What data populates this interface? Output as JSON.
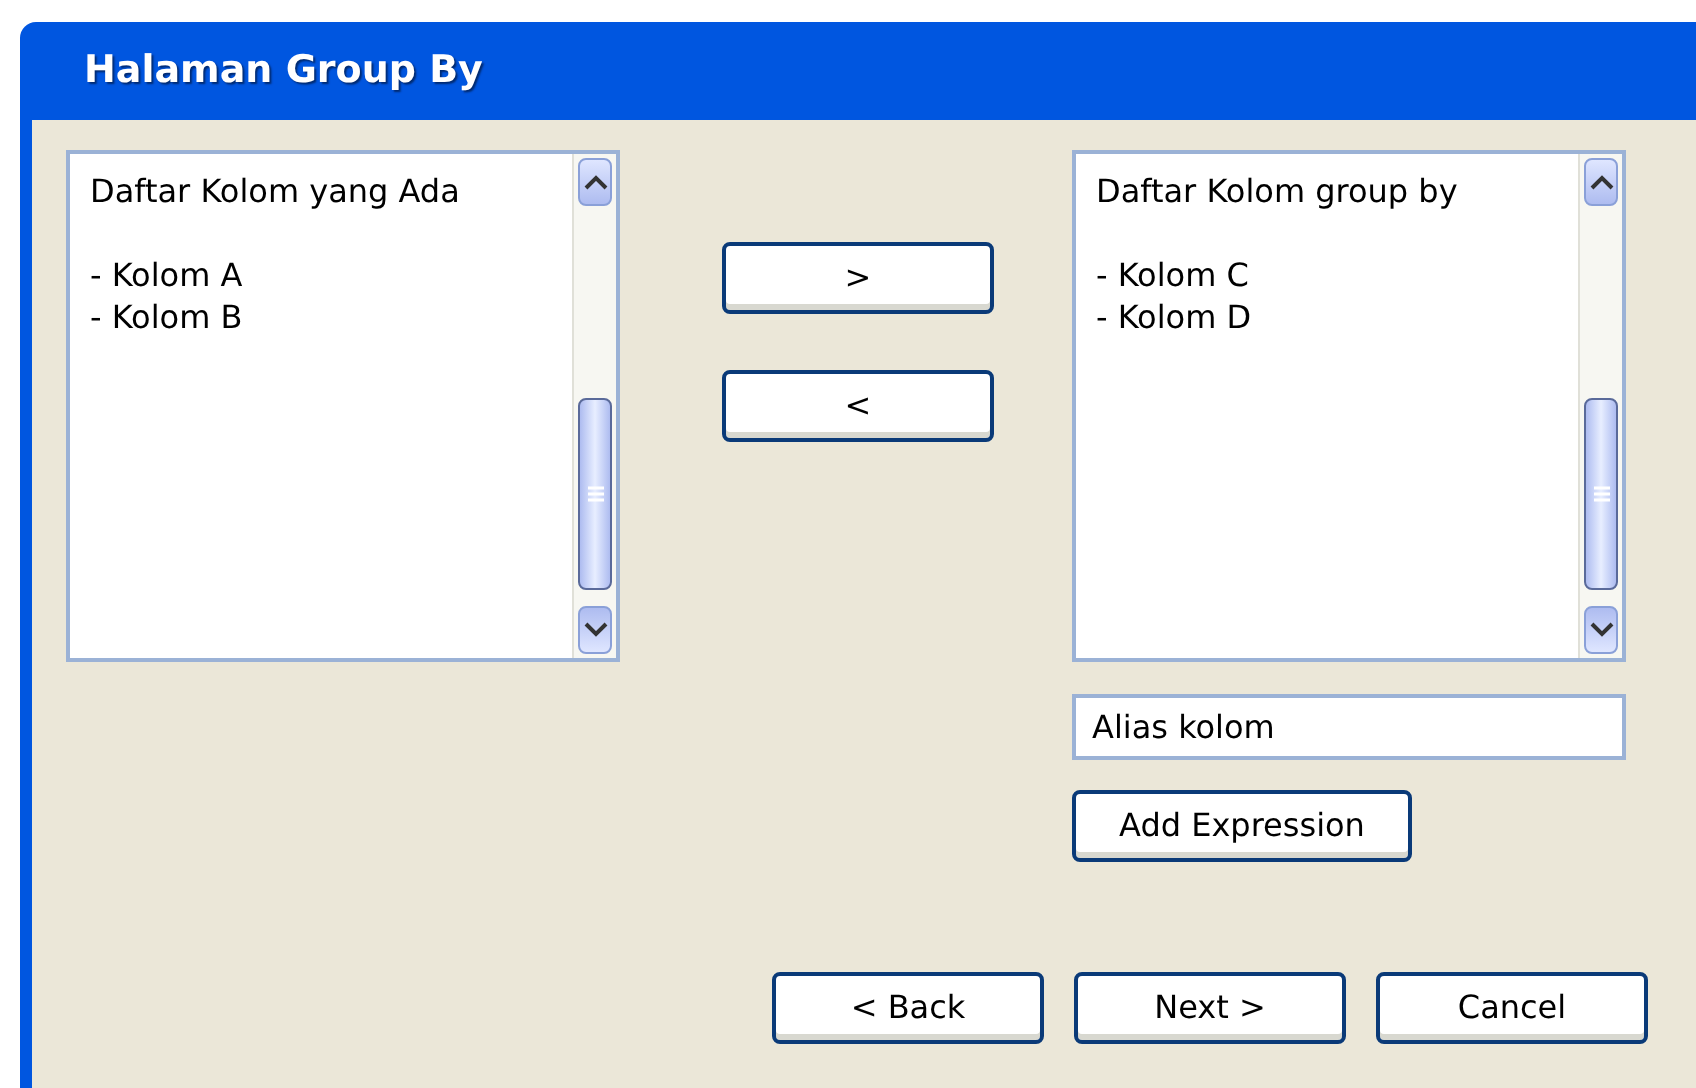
{
  "window": {
    "title": "Halaman Group By"
  },
  "available_list": {
    "title": "Daftar Kolom yang Ada",
    "items": [
      "- Kolom A",
      "- Kolom B"
    ]
  },
  "move_buttons": [
    ">",
    "<"
  ],
  "group_by_list": {
    "title": "Daftar Kolom group by",
    "items": [
      "- Kolom C",
      "- Kolom D"
    ]
  },
  "alias_field": {
    "placeholder": "Alias kolom"
  },
  "add_expression_button": "Add Expression",
  "footer_buttons": [
    "< Back",
    "Next >",
    "Cancel"
  ]
}
